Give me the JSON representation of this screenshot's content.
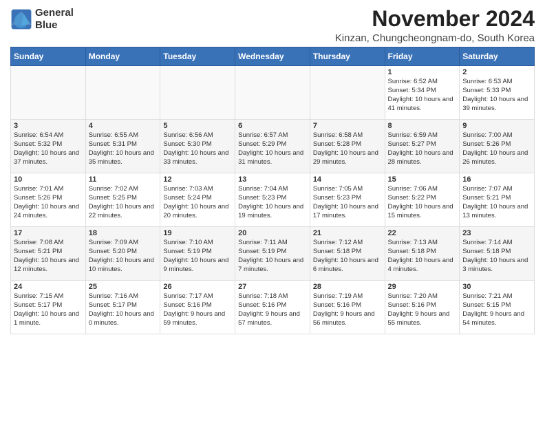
{
  "logo": {
    "line1": "General",
    "line2": "Blue"
  },
  "title": "November 2024",
  "subtitle": "Kinzan, Chungcheongnam-do, South Korea",
  "days_of_week": [
    "Sunday",
    "Monday",
    "Tuesday",
    "Wednesday",
    "Thursday",
    "Friday",
    "Saturday"
  ],
  "weeks": [
    [
      {
        "day": "",
        "info": ""
      },
      {
        "day": "",
        "info": ""
      },
      {
        "day": "",
        "info": ""
      },
      {
        "day": "",
        "info": ""
      },
      {
        "day": "",
        "info": ""
      },
      {
        "day": "1",
        "info": "Sunrise: 6:52 AM\nSunset: 5:34 PM\nDaylight: 10 hours and 41 minutes."
      },
      {
        "day": "2",
        "info": "Sunrise: 6:53 AM\nSunset: 5:33 PM\nDaylight: 10 hours and 39 minutes."
      }
    ],
    [
      {
        "day": "3",
        "info": "Sunrise: 6:54 AM\nSunset: 5:32 PM\nDaylight: 10 hours and 37 minutes."
      },
      {
        "day": "4",
        "info": "Sunrise: 6:55 AM\nSunset: 5:31 PM\nDaylight: 10 hours and 35 minutes."
      },
      {
        "day": "5",
        "info": "Sunrise: 6:56 AM\nSunset: 5:30 PM\nDaylight: 10 hours and 33 minutes."
      },
      {
        "day": "6",
        "info": "Sunrise: 6:57 AM\nSunset: 5:29 PM\nDaylight: 10 hours and 31 minutes."
      },
      {
        "day": "7",
        "info": "Sunrise: 6:58 AM\nSunset: 5:28 PM\nDaylight: 10 hours and 29 minutes."
      },
      {
        "day": "8",
        "info": "Sunrise: 6:59 AM\nSunset: 5:27 PM\nDaylight: 10 hours and 28 minutes."
      },
      {
        "day": "9",
        "info": "Sunrise: 7:00 AM\nSunset: 5:26 PM\nDaylight: 10 hours and 26 minutes."
      }
    ],
    [
      {
        "day": "10",
        "info": "Sunrise: 7:01 AM\nSunset: 5:26 PM\nDaylight: 10 hours and 24 minutes."
      },
      {
        "day": "11",
        "info": "Sunrise: 7:02 AM\nSunset: 5:25 PM\nDaylight: 10 hours and 22 minutes."
      },
      {
        "day": "12",
        "info": "Sunrise: 7:03 AM\nSunset: 5:24 PM\nDaylight: 10 hours and 20 minutes."
      },
      {
        "day": "13",
        "info": "Sunrise: 7:04 AM\nSunset: 5:23 PM\nDaylight: 10 hours and 19 minutes."
      },
      {
        "day": "14",
        "info": "Sunrise: 7:05 AM\nSunset: 5:23 PM\nDaylight: 10 hours and 17 minutes."
      },
      {
        "day": "15",
        "info": "Sunrise: 7:06 AM\nSunset: 5:22 PM\nDaylight: 10 hours and 15 minutes."
      },
      {
        "day": "16",
        "info": "Sunrise: 7:07 AM\nSunset: 5:21 PM\nDaylight: 10 hours and 13 minutes."
      }
    ],
    [
      {
        "day": "17",
        "info": "Sunrise: 7:08 AM\nSunset: 5:21 PM\nDaylight: 10 hours and 12 minutes."
      },
      {
        "day": "18",
        "info": "Sunrise: 7:09 AM\nSunset: 5:20 PM\nDaylight: 10 hours and 10 minutes."
      },
      {
        "day": "19",
        "info": "Sunrise: 7:10 AM\nSunset: 5:19 PM\nDaylight: 10 hours and 9 minutes."
      },
      {
        "day": "20",
        "info": "Sunrise: 7:11 AM\nSunset: 5:19 PM\nDaylight: 10 hours and 7 minutes."
      },
      {
        "day": "21",
        "info": "Sunrise: 7:12 AM\nSunset: 5:18 PM\nDaylight: 10 hours and 6 minutes."
      },
      {
        "day": "22",
        "info": "Sunrise: 7:13 AM\nSunset: 5:18 PM\nDaylight: 10 hours and 4 minutes."
      },
      {
        "day": "23",
        "info": "Sunrise: 7:14 AM\nSunset: 5:18 PM\nDaylight: 10 hours and 3 minutes."
      }
    ],
    [
      {
        "day": "24",
        "info": "Sunrise: 7:15 AM\nSunset: 5:17 PM\nDaylight: 10 hours and 1 minute."
      },
      {
        "day": "25",
        "info": "Sunrise: 7:16 AM\nSunset: 5:17 PM\nDaylight: 10 hours and 0 minutes."
      },
      {
        "day": "26",
        "info": "Sunrise: 7:17 AM\nSunset: 5:16 PM\nDaylight: 9 hours and 59 minutes."
      },
      {
        "day": "27",
        "info": "Sunrise: 7:18 AM\nSunset: 5:16 PM\nDaylight: 9 hours and 57 minutes."
      },
      {
        "day": "28",
        "info": "Sunrise: 7:19 AM\nSunset: 5:16 PM\nDaylight: 9 hours and 56 minutes."
      },
      {
        "day": "29",
        "info": "Sunrise: 7:20 AM\nSunset: 5:16 PM\nDaylight: 9 hours and 55 minutes."
      },
      {
        "day": "30",
        "info": "Sunrise: 7:21 AM\nSunset: 5:15 PM\nDaylight: 9 hours and 54 minutes."
      }
    ]
  ]
}
